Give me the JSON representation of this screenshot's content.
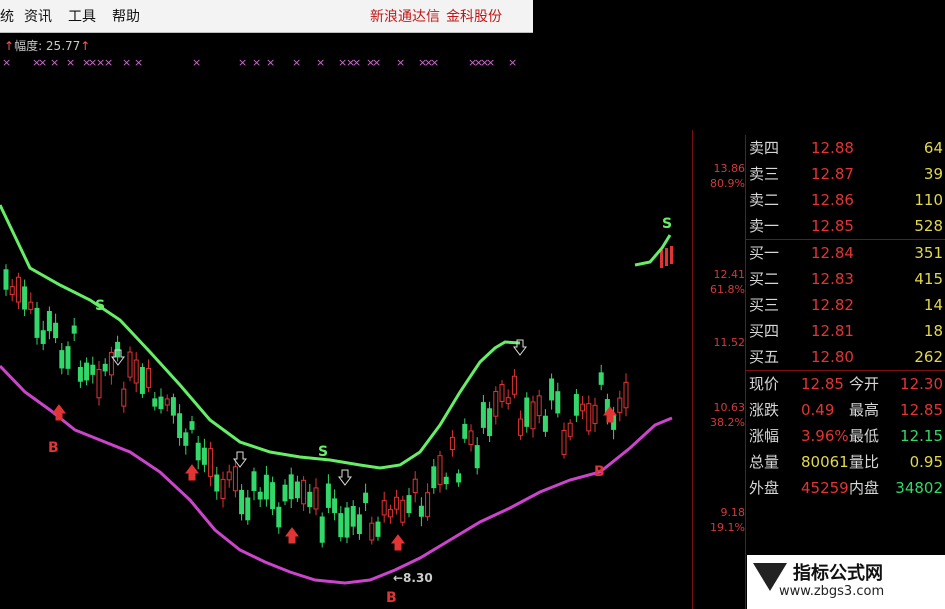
{
  "menu": {
    "items": [
      "统",
      "资讯",
      "工具",
      "帮助"
    ],
    "brand1": "新浪通达信",
    "brand2": "金科股份"
  },
  "amplitude": {
    "label": "幅度: 25.77",
    "arrow": "↑"
  },
  "signal_marks": "×",
  "price_axis": {
    "ticks": [
      "13.86",
      "12.41",
      "11.52",
      "10.63",
      "9.18"
    ],
    "pcts": [
      "80.9%",
      "61.8%",
      "38.2%",
      "19.1%"
    ]
  },
  "chart_labels": {
    "low": "←8.30",
    "buy": "B",
    "sell": "S"
  },
  "order_book": {
    "asks": [
      {
        "label": "卖四",
        "price": "12.88",
        "vol": "64"
      },
      {
        "label": "卖三",
        "price": "12.87",
        "vol": "39"
      },
      {
        "label": "卖二",
        "price": "12.86",
        "vol": "110"
      },
      {
        "label": "卖一",
        "price": "12.85",
        "vol": "528"
      }
    ],
    "bids": [
      {
        "label": "买一",
        "price": "12.84",
        "vol": "351"
      },
      {
        "label": "买二",
        "price": "12.83",
        "vol": "415"
      },
      {
        "label": "买三",
        "price": "12.82",
        "vol": "14"
      },
      {
        "label": "买四",
        "price": "12.81",
        "vol": "18"
      },
      {
        "label": "买五",
        "price": "12.80",
        "vol": "262"
      }
    ]
  },
  "stats": [
    {
      "l1": "现价",
      "v1": "12.85",
      "l2": "今开",
      "v2": "12.30"
    },
    {
      "l1": "涨跌",
      "v1": "0.49",
      "l2": "最高",
      "v2": "12.85"
    },
    {
      "l1": "涨幅",
      "v1": "3.96%",
      "l2": "最低",
      "v2": "12.15"
    },
    {
      "l1": "总量",
      "v1": "80061",
      "l2": "量比",
      "v2": "0.95"
    },
    {
      "l1": "外盘",
      "v1": "45259",
      "l2": "内盘",
      "v2": "34802"
    }
  ],
  "watermark": {
    "title": "指标公式网",
    "url": "www.zbgs3.com"
  },
  "colors": {
    "up": "#e23434",
    "down": "#33d86a",
    "upper_band": "#66ee66",
    "lower_band": "#cc44cc"
  }
}
